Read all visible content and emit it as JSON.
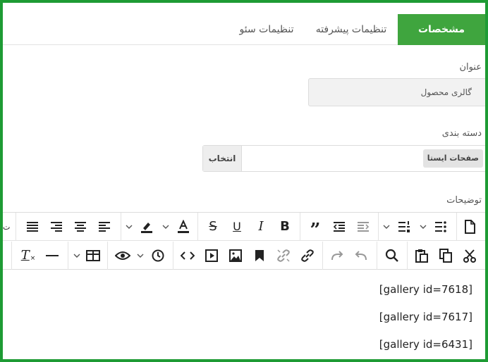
{
  "tabs": {
    "specs": "مشخصات",
    "advanced": "تنظیمات پیشرفته",
    "seo": "تنظیمات سئو"
  },
  "fields": {
    "title_label": "عنوان",
    "title_value": "گالری محصول",
    "category_label": "دسته بندی",
    "category_chip": "صفحات ایستا",
    "category_select_button": "انتخاب",
    "description_label": "توضیحات"
  },
  "toolbar": {
    "row1_icons": [
      "document-icon",
      "bullet-list-icon",
      "numbered-list-icon",
      "indent-icon",
      "outdent-icon",
      "blockquote-icon",
      "bold-icon",
      "italic-icon",
      "underline-icon",
      "strikethrough-icon",
      "font-color-icon",
      "highlight-icon",
      "align-left-icon",
      "align-center-icon",
      "align-right-icon",
      "justify-icon"
    ],
    "row2_icons": [
      "cut-icon",
      "copy-icon",
      "paste-icon",
      "search-icon",
      "undo-icon",
      "redo-icon",
      "link-icon",
      "unlink-icon",
      "bookmark-icon",
      "image-icon",
      "media-icon",
      "code-icon",
      "history-icon",
      "preview-icon",
      "table-icon",
      "horizontal-line-icon",
      "clear-format-icon"
    ],
    "cut_text": "ت"
  },
  "content": {
    "lines": [
      "[gallery id=7618]",
      "[gallery id=7617]",
      "[gallery id=6431]"
    ]
  },
  "colors": {
    "accent_green": "#3fa53e",
    "frame_green": "#1e9b34"
  }
}
